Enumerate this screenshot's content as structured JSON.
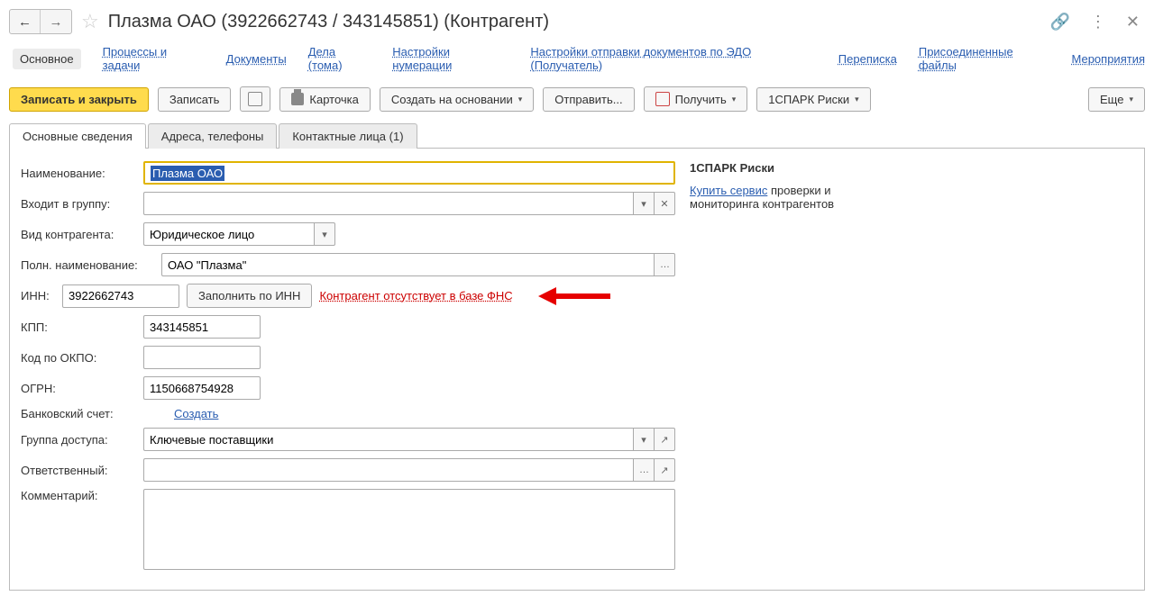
{
  "title": "Плазма ОАО (3922662743 / 343145851) (Контрагент)",
  "topnav": {
    "main_tab": "Основное",
    "links": [
      "Процессы и задачи",
      "Документы",
      "Дела (тома)",
      "Настройки нумерации",
      "Настройки отправки документов по ЭДО (Получатель)",
      "Переписка",
      "Присоединенные файлы",
      "Мероприятия"
    ]
  },
  "toolbar": {
    "save_close": "Записать и закрыть",
    "save": "Записать",
    "card": "Карточка",
    "create_based": "Создать на основании",
    "send": "Отправить...",
    "receive": "Получить",
    "spark": "1СПАРК Риски",
    "more": "Еще"
  },
  "tabs": {
    "t1": "Основные сведения",
    "t2": "Адреса, телефоны",
    "t3": "Контактные лица (1)"
  },
  "labels": {
    "name": "Наименование:",
    "group": "Входит в группу:",
    "type": "Вид контрагента:",
    "full_name": "Полн. наименование:",
    "inn": "ИНН:",
    "fill_by_inn": "Заполнить по ИНН",
    "fns_error": "Контрагент отсутствует в базе ФНС",
    "kpp": "КПП:",
    "okpo": "Код по ОКПО:",
    "ogrn": "ОГРН:",
    "bank": "Банковский счет:",
    "create_link": "Создать",
    "access_group": "Группа доступа:",
    "responsible": "Ответственный:",
    "comment": "Комментарий:"
  },
  "values": {
    "name": "Плазма ОАО",
    "group": "",
    "type": "Юридическое лицо",
    "full_name": "ОАО \"Плазма\"",
    "inn": "3922662743",
    "kpp": "343145851",
    "okpo": "",
    "ogrn": "1150668754928",
    "access_group": "Ключевые поставщики",
    "responsible": "",
    "comment": ""
  },
  "side": {
    "heading": "1СПАРК Риски",
    "buy_link": "Купить сервис",
    "desc_rest": " проверки и мониторинга контрагентов"
  }
}
